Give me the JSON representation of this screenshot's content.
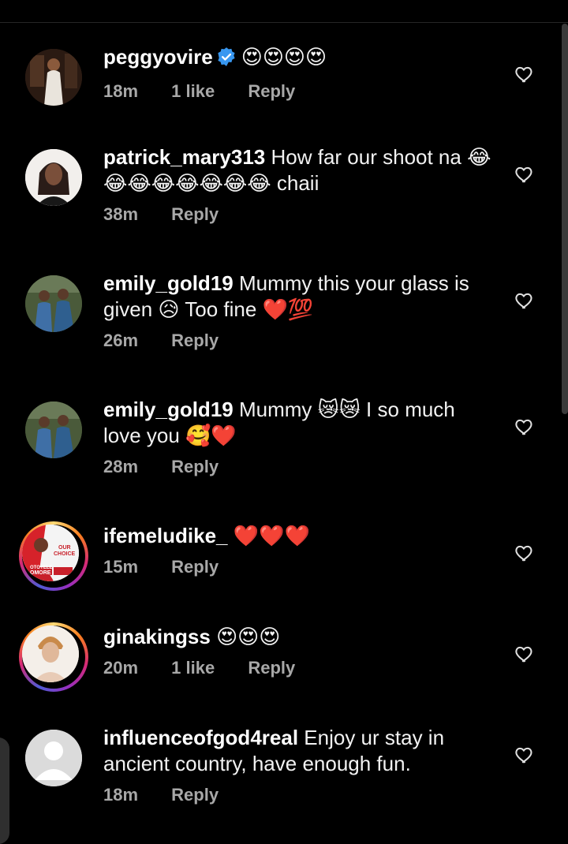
{
  "colors": {
    "background": "#000000",
    "meta": "#a8a8a8",
    "verified": "#3897f0",
    "heart_red": "#e0245e"
  },
  "comments": [
    {
      "username": "peggyovire",
      "verified": true,
      "text": "😍😍😍😍",
      "time": "18m",
      "likes": "1 like",
      "reply": "Reply"
    },
    {
      "username": "patrick_mary313",
      "text": "How far our shoot na 😂😂😂😂😂😂😂😂 chaii",
      "time": "38m",
      "reply": "Reply"
    },
    {
      "username": "emily_gold19",
      "text": "Mummy this your glass is given 😥 Too fine ❤️💯",
      "time": "26m",
      "reply": "Reply"
    },
    {
      "username": "emily_gold19",
      "text": "Mummy 😿😿 I so much love you 🥰❤️",
      "time": "28m",
      "reply": "Reply"
    },
    {
      "username": "ifemeludike_",
      "text": "❤️❤️❤️",
      "time": "15m",
      "reply": "Reply",
      "avatar_text": [
        "OUR",
        "CHOICE",
        "OTOYELE",
        "OMORE"
      ]
    },
    {
      "username": "ginakingss",
      "text": "😍😍😍",
      "time": "20m",
      "likes": "1 like",
      "reply": "Reply"
    },
    {
      "username": "influenceofgod4real",
      "text": "Enjoy ur stay in ancient country,  have enough fun.",
      "time": "18m",
      "reply": "Reply"
    }
  ],
  "icons": {
    "like": "heart-outline-icon",
    "verified": "verified-badge-icon"
  }
}
